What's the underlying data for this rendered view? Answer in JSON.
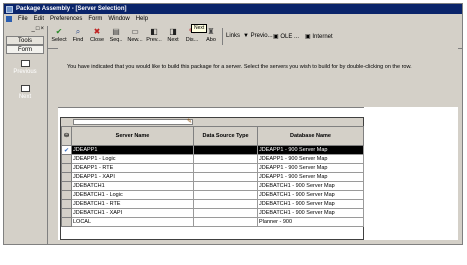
{
  "window": {
    "title": "Package Assembly - [Server Selection]"
  },
  "menu": [
    "File",
    "Edit",
    "Preferences",
    "Form",
    "Window",
    "Help"
  ],
  "left_panel": {
    "tabs": [
      "Tools",
      "Form"
    ],
    "nav": [
      {
        "label": "Previous",
        "icon": "previous-icon"
      },
      {
        "label": "Next",
        "icon": "next-icon"
      }
    ]
  },
  "toolbar": {
    "buttons": [
      {
        "label": "Select",
        "icon": "check-icon",
        "glyph": "✔",
        "color": "#2a8a2a"
      },
      {
        "label": "Find",
        "icon": "find-icon",
        "glyph": "🔍",
        "color": "#2b4a8a"
      },
      {
        "label": "Close",
        "icon": "close-icon",
        "glyph": "✖",
        "color": "#c02020"
      },
      {
        "label": "Seq..",
        "icon": "sequence-icon",
        "glyph": "▤",
        "color": "#444"
      },
      {
        "label": "New...",
        "icon": "new-icon",
        "glyph": "▭",
        "color": "#444"
      },
      {
        "label": "Prev...",
        "icon": "prev-icon",
        "glyph": "◧",
        "color": "#222"
      },
      {
        "label": "Next",
        "icon": "next-icon",
        "glyph": "◨",
        "color": "#222"
      },
      {
        "label": "Dis...",
        "icon": "display-icon",
        "glyph": "✎",
        "color": "#b22"
      },
      {
        "label": "Abo",
        "icon": "about-icon",
        "glyph": "♜",
        "color": "#444"
      }
    ],
    "links_label": "Links",
    "link_items": [
      "Previo...",
      "OLE ...",
      "Internet"
    ],
    "tooltip": "Next"
  },
  "instruction": "You have indicated that you would like to build this package for a server.  Select the servers you wish to build for by double-clicking on the row.",
  "grid": {
    "columns": [
      "Server Name",
      "Data Source Type",
      "Database Name"
    ],
    "rows": [
      {
        "server": "JDEAPP1",
        "type": "",
        "db": "JDEAPP1 - 900 Server Map",
        "selected": true
      },
      {
        "server": "JDEAPP1 - Logic",
        "type": "",
        "db": "JDEAPP1 - 900 Server Map",
        "selected": false
      },
      {
        "server": "JDEAPP1 - RTE",
        "type": "",
        "db": "JDEAPP1 - 900 Server Map",
        "selected": false
      },
      {
        "server": "JDEAPP1 - XAPI",
        "type": "",
        "db": "JDEAPP1 - 900 Server Map",
        "selected": false
      },
      {
        "server": "JDEBATCH1",
        "type": "",
        "db": "JDEBATCH1 - 900 Server Map",
        "selected": false
      },
      {
        "server": "JDEBATCH1 - Logic",
        "type": "",
        "db": "JDEBATCH1 - 900 Server Map",
        "selected": false
      },
      {
        "server": "JDEBATCH1 - RTE",
        "type": "",
        "db": "JDEBATCH1 - 900 Server Map",
        "selected": false
      },
      {
        "server": "JDEBATCH1 - XAPI",
        "type": "",
        "db": "JDEBATCH1 - 900 Server Map",
        "selected": false
      },
      {
        "server": "LOCAL",
        "type": "",
        "db": "Planner - 900",
        "selected": false
      }
    ]
  },
  "colors": {
    "titlebar": "#0a246a",
    "face": "#d4d0c8",
    "selected_row": "#000000"
  }
}
